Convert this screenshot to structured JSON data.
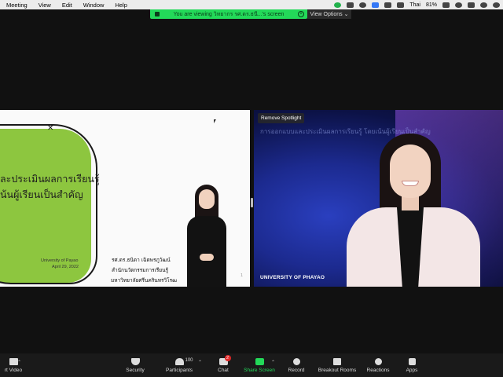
{
  "menubar": {
    "items": [
      "Meeting",
      "View",
      "Edit",
      "Window",
      "Help"
    ],
    "input_source": "Thai",
    "battery": "81%"
  },
  "share_banner": {
    "text": "You are viewing วิทยากร รศ.ดร.ธนี...'s screen",
    "view_options": "View Options ⌄"
  },
  "slide": {
    "title_line1": "ละประเมินผลการเรียนรู้",
    "title_line2": "น้นผู้เรียนเป็นสำคัญ",
    "university": "University of Payao",
    "date": "April 29, 2022",
    "speaker_name": "รศ.ดร.ธนิดา เฉิดพรภูวัฒน์",
    "speaker_dept": "สำนักนวัตกรรมการเรียนรู้",
    "speaker_university": "มหาวิทยาลัยศรีนครินทรวิโรฒ",
    "slide_number": "1"
  },
  "video": {
    "remove_spotlight": "Remove Spotlight",
    "background_text": "การออกแบบและประเมินผลการเรียนรู้ โดยเน้นผู้เรียนเป็นสำคัญ",
    "name_label": "UNIVERSITY OF PHAYAO"
  },
  "toolbar": {
    "start_video": "rt Video",
    "security": "Security",
    "participants": "Participants",
    "participants_count": "100",
    "chat": "Chat",
    "chat_badge": "2",
    "share_screen": "Share Screen",
    "record": "Record",
    "breakout_rooms": "Breakout Rooms",
    "reactions": "Reactions",
    "apps": "Apps"
  },
  "colors": {
    "share_green": "#23d959",
    "slide_blob_green": "#8dc63f",
    "toolbar_bg": "#1a1a1a"
  }
}
